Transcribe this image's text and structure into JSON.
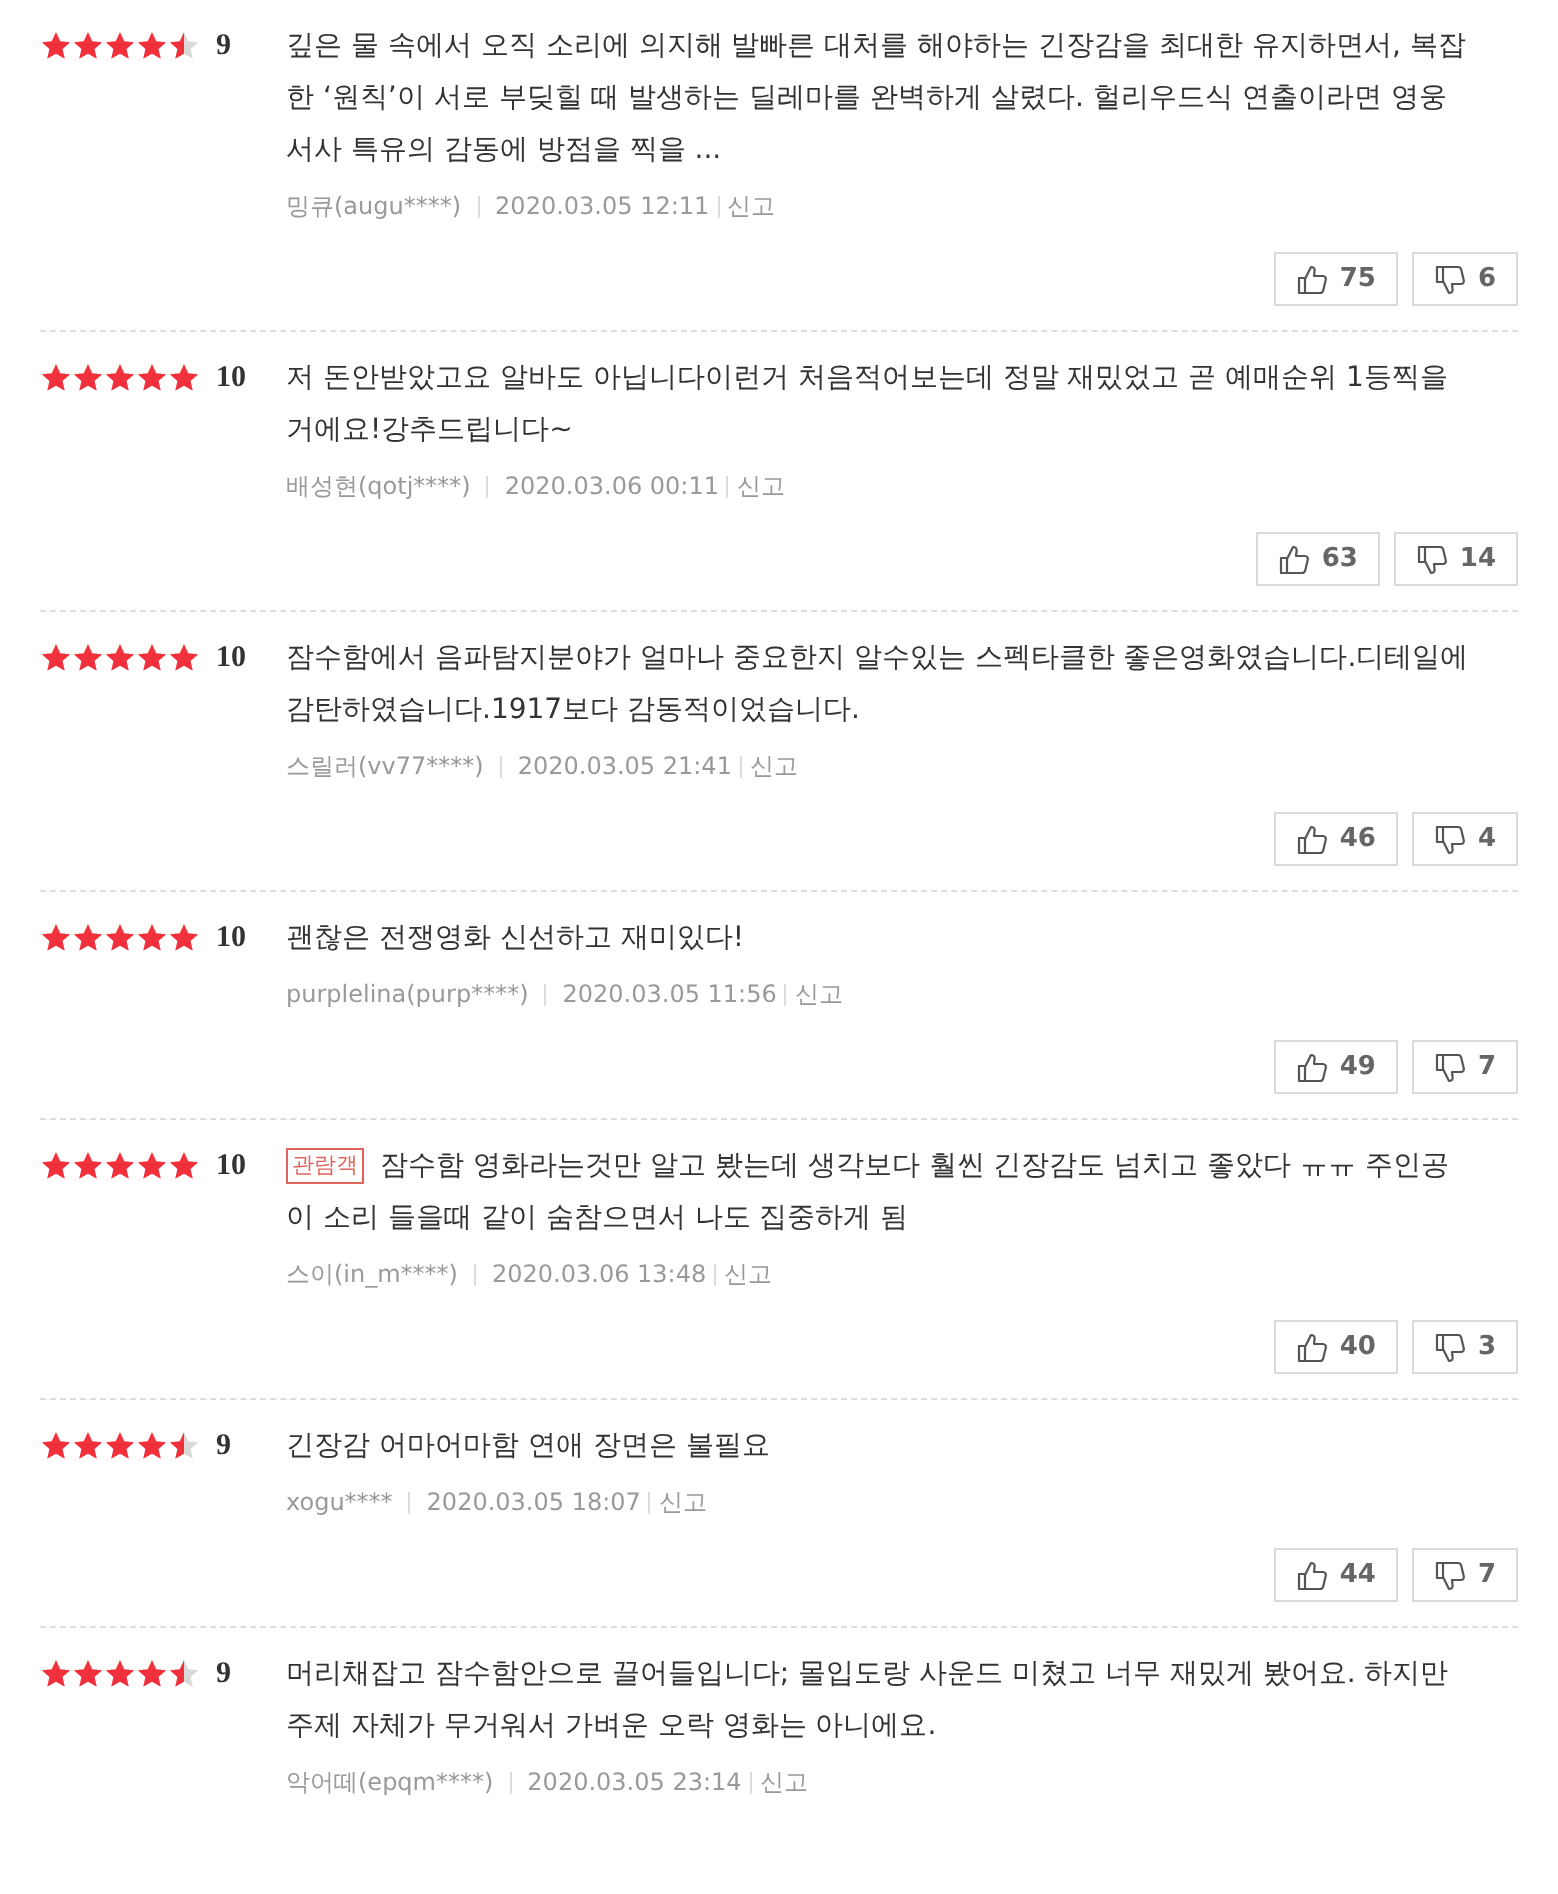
{
  "reviews": [
    {
      "stars": 4.5,
      "score": "9",
      "text": "깊은 물 속에서 오직 소리에 의지해 발빠른 대처를 해야하는 긴장감을 최대한 유지하면서, 복잡한 ‘원칙’이 서로 부딪힐 때 발생하는 딜레마를 완벽하게 살렸다. 헐리우드식 연출이라면 영웅서사 특유의 감동에 방점을 찍을 ...",
      "author": "밍큐(augu****)",
      "date": "2020.03.05 12:11",
      "report": "신고",
      "likes": "75",
      "dislikes": "6"
    },
    {
      "stars": 5,
      "score": "10",
      "text": "저 돈안받았고요 알바도 아닙니다이런거 처음적어보는데 정말 재밌었고 곧 예매순위 1등찍을거에요!강추드립니다~",
      "author": "배성현(qotj****)",
      "date": "2020.03.06 00:11",
      "report": "신고",
      "likes": "63",
      "dislikes": "14"
    },
    {
      "stars": 5,
      "score": "10",
      "text": "잠수함에서 음파탐지분야가 얼마나 중요한지 알수있는 스펙타클한 좋은영화였습니다.디테일에 감탄하였습니다.1917보다 감동적이었습니다.",
      "author": "스릴러(vv77****)",
      "date": "2020.03.05 21:41",
      "report": "신고",
      "likes": "46",
      "dislikes": "4"
    },
    {
      "stars": 5,
      "score": "10",
      "text": "괜찮은 전쟁영화 신선하고 재미있다!",
      "author": "purplelina(purp****)",
      "date": "2020.03.05 11:56",
      "report": "신고",
      "likes": "49",
      "dislikes": "7"
    },
    {
      "stars": 5,
      "score": "10",
      "badge": "관람객",
      "text": "잠수함 영화라는것만 알고 봤는데 생각보다 훨씬 긴장감도 넘치고 좋았다 ㅠㅠ 주인공이 소리 들을때 같이 숨참으면서 나도 집중하게 됨",
      "author": "스이(in_m****)",
      "date": "2020.03.06 13:48",
      "report": "신고",
      "likes": "40",
      "dislikes": "3"
    },
    {
      "stars": 4.5,
      "score": "9",
      "text": "긴장감 어마어마함 연애 장면은 불필요",
      "author": "xogu****",
      "date": "2020.03.05 18:07",
      "report": "신고",
      "likes": "44",
      "dislikes": "7"
    },
    {
      "stars": 4.5,
      "score": "9",
      "text": "머리채잡고 잠수함안으로 끌어들입니다; 몰입도랑 사운드 미쳤고 너무 재밌게 봤어요. 하지만 주제 자체가 무거워서 가벼운 오락 영화는 아니에요.",
      "author": "악어떼(epqm****)",
      "date": "2020.03.05 23:14",
      "report": "신고"
    }
  ]
}
